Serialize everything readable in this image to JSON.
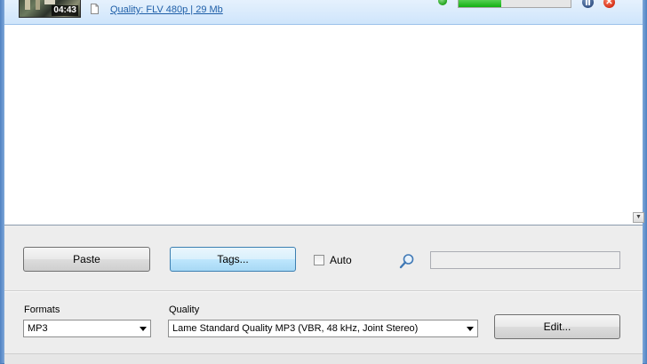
{
  "download": {
    "duration": "04:43",
    "quality_text": "Quality: FLV   480p | 29 Mb",
    "progress_percent": 38
  },
  "toolbar": {
    "paste_label": "Paste",
    "tags_label": "Tags...",
    "auto_label": "Auto",
    "auto_checked": false,
    "search_value": ""
  },
  "output": {
    "formats_label": "Formats",
    "format_value": "MP3",
    "quality_label": "Quality",
    "quality_value": "Lame Standard Quality MP3  (VBR, 48 kHz, Joint Stereo)",
    "edit_label": "Edit..."
  },
  "colors": {
    "row_highlight": "#cfe5fb",
    "progress_green": "#12b012",
    "link_blue": "#1f5fa8"
  }
}
